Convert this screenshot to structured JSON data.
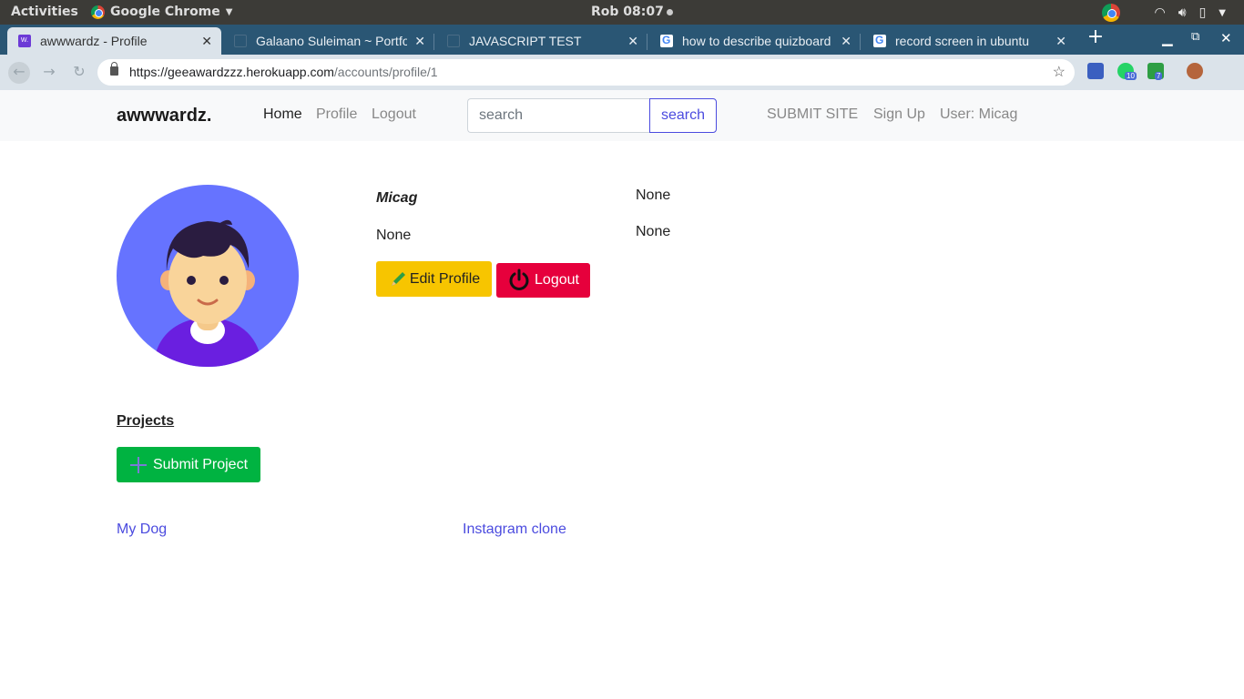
{
  "os_bar": {
    "activities": "Activities",
    "app_name": "Google Chrome",
    "clock": "Rob 08:07"
  },
  "browser": {
    "tabs": [
      {
        "title": "awwwardz - Profile",
        "favicon": "awwwardz-favicon-icon",
        "active": true
      },
      {
        "title": "Galaano Suleiman ~ Portfolio",
        "favicon": "document-icon",
        "active": false
      },
      {
        "title": "JAVASCRIPT TEST",
        "favicon": "document-icon",
        "active": false
      },
      {
        "title": "how to describe quizboard",
        "favicon": "google-icon",
        "active": false
      },
      {
        "title": "record screen in ubuntu",
        "favicon": "google-icon",
        "active": false
      }
    ],
    "url_host": "https://geeawardzzz.herokuapp.com",
    "url_path": "/accounts/profile/1",
    "extension_badges": [
      "10",
      "7"
    ]
  },
  "navbar": {
    "brand": "awwwardz.",
    "links": [
      "Home",
      "Profile",
      "Logout"
    ],
    "search_placeholder": "search",
    "search_button": "search",
    "right_links": [
      "SUBMIT SITE",
      "Sign Up",
      "User: Micag"
    ]
  },
  "profile": {
    "username": "Micag",
    "bio": "None",
    "field1": "None",
    "field2": "None",
    "edit_button": "Edit Profile",
    "logout_button": "Logout"
  },
  "projects": {
    "heading": "Projects",
    "submit_button": "Submit Project",
    "items": [
      "My Dog",
      "Instagram clone"
    ]
  },
  "colors": {
    "primary_link": "#4b4bdf",
    "edit_button": "#f7c500",
    "logout_button": "#e6003c",
    "submit_button": "#00b341",
    "avatar_bg": "#6673ff"
  }
}
